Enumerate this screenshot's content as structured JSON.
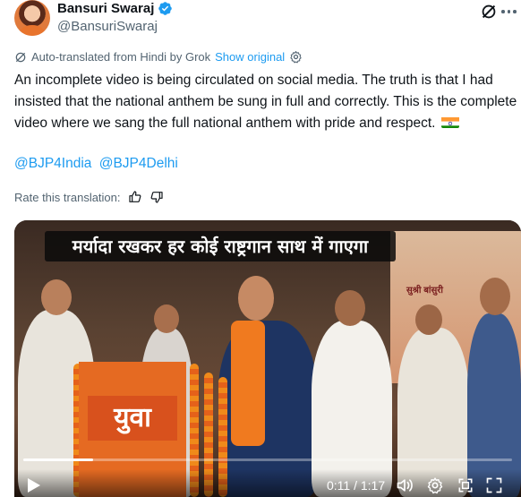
{
  "author": {
    "display_name": "Bansuri Swaraj",
    "handle": "@BansuriSwaraj"
  },
  "translation": {
    "notice": "Auto-translated from Hindi by Grok",
    "show_original": "Show original"
  },
  "tweet": {
    "text": "An incomplete video is being circulated on social media. The truth is that I had insisted that the national anthem be sung in full and correctly. This is the complete video where we sang the full national anthem with pride and respect.",
    "mentions": [
      "@BJP4India",
      "@BJP4Delhi"
    ]
  },
  "rating": {
    "label": "Rate this translation:"
  },
  "video": {
    "caption": "मर्यादा रखकर हर कोई राष्ट्रगान साथ में गाएगा",
    "podium_sign": "युवा",
    "banner_text": "सुश्री बांसुरी",
    "time_display": "0:11 / 1:17",
    "progress_fraction": 0.143
  },
  "colors": {
    "link": "#1d9bf0",
    "secondary_text": "#536471",
    "primary_text": "#0f1419",
    "verified": "#1d9bf0"
  },
  "icons": {
    "verified": "verified-badge-icon",
    "grok": "grok-icon",
    "more": "more-icon",
    "translate": "grok-translate-icon",
    "settings": "settings-gear-icon",
    "thumb_up": "thumbs-up-icon",
    "thumb_down": "thumbs-down-icon",
    "play": "play-icon",
    "volume": "volume-icon",
    "video_settings": "video-settings-icon",
    "expand": "expand-icon",
    "fullscreen": "fullscreen-icon"
  }
}
